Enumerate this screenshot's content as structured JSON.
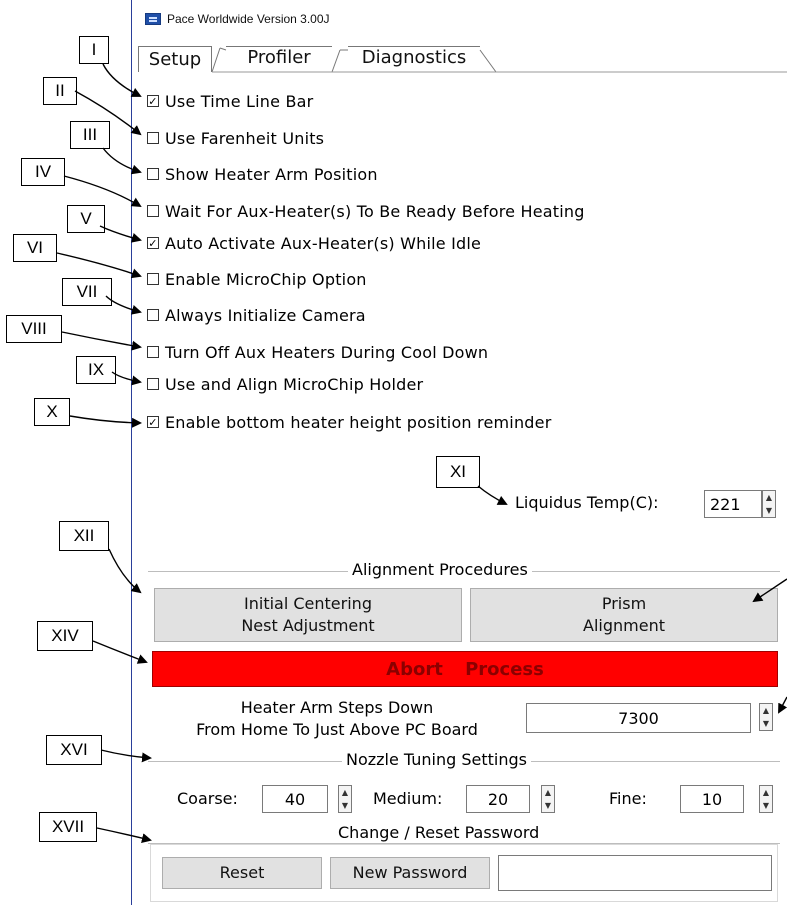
{
  "window": {
    "title": "Pace Worldwide Version 3.00J"
  },
  "tabs": [
    {
      "label": "Setup",
      "active": true
    },
    {
      "label": "Profiler",
      "active": false
    },
    {
      "label": "Diagnostics",
      "active": false
    }
  ],
  "options": [
    {
      "label": "Use Time Line Bar",
      "checked": true
    },
    {
      "label": "Use Farenheit Units",
      "checked": false
    },
    {
      "label": "Show Heater Arm Position",
      "checked": false
    },
    {
      "label": "Wait For Aux-Heater(s) To Be Ready Before Heating",
      "checked": false
    },
    {
      "label": "Auto Activate Aux-Heater(s) While Idle",
      "checked": true
    },
    {
      "label": "Enable MicroChip Option",
      "checked": false
    },
    {
      "label": "Always Initialize Camera",
      "checked": false
    },
    {
      "label": "Turn Off Aux Heaters During Cool Down",
      "checked": false
    },
    {
      "label": "Use and Align MicroChip Holder",
      "checked": false
    },
    {
      "label": "Enable bottom heater height position reminder",
      "checked": true
    }
  ],
  "liquidus": {
    "label": "Liquidus Temp(C):",
    "value": "221"
  },
  "alignment": {
    "title": "Alignment Procedures",
    "initial_line1": "Initial Centering",
    "initial_line2": "Nest Adjustment",
    "prism_line1": "Prism",
    "prism_line2": "Alignment"
  },
  "abort": {
    "label": "Abort  Process"
  },
  "heater_steps": {
    "line1": "Heater Arm Steps Down",
    "line2": "From Home To Just Above PC Board",
    "value": "7300"
  },
  "nozzle": {
    "title": "Nozzle Tuning Settings",
    "coarse_label": "Coarse:",
    "coarse_value": "40",
    "medium_label": "Medium:",
    "medium_value": "20",
    "fine_label": "Fine:",
    "fine_value": "10"
  },
  "password": {
    "title": "Change / Reset Password",
    "reset_label": "Reset",
    "new_label": "New Password",
    "field_value": ""
  },
  "annotations": [
    "I",
    "II",
    "III",
    "IV",
    "V",
    "VI",
    "VII",
    "VIII",
    "IX",
    "X",
    "XI",
    "XII",
    "XIV",
    "XVI",
    "XVII"
  ],
  "colors": {
    "abort_bg": "#ff0000",
    "abort_text": "#8b0000",
    "icon": "#1f4fa8"
  }
}
